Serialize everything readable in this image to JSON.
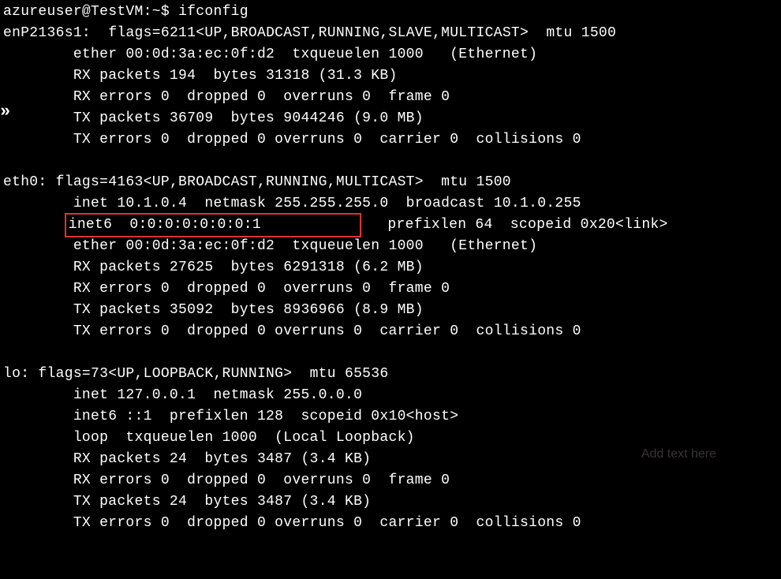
{
  "prompt": {
    "user_host": "azureuser@TestVM",
    "path": ":~$",
    "command": "ifconfig"
  },
  "side_marker": "»",
  "interfaces": {
    "enp": {
      "name": "enP2136s1:",
      "flags_line": "  flags=6211<UP,BROADCAST,RUNNING,SLAVE,MULTICAST>  mtu 1500",
      "ether_line": "        ether 00:0d:3a:ec:0f:d2  txqueuelen 1000   (Ethernet)",
      "rx_packets": "        RX packets 194  bytes 31318 (31.3 KB)",
      "rx_errors": "        RX errors 0  dropped 0  overruns 0  frame 0",
      "tx_packets": "        TX packets 36709  bytes 9044246 (9.0 MB)",
      "tx_errors": "        TX errors 0  dropped 0 overruns 0  carrier 0  collisions 0"
    },
    "eth0": {
      "name": "eth0:",
      "flags_line": " flags=4163<UP,BROADCAST,RUNNING,MULTICAST>  mtu 1500",
      "inet_line": "        inet 10.1.0.4  netmask 255.255.255.0  broadcast 10.1.0.255",
      "inet6_highlighted": "inet6  0:0:0:0:0:0:0:1           ",
      "inet6_suffix": "   prefixlen 64  scopeid 0x20<link>",
      "inet6_prefix": "       ",
      "ether_line": "        ether 00:0d:3a:ec:0f:d2  txqueuelen 1000   (Ethernet)",
      "rx_packets": "        RX packets 27625  bytes 6291318 (6.2 MB)",
      "rx_errors": "        RX errors 0  dropped 0  overruns 0  frame 0",
      "tx_packets": "        TX packets 35092  bytes 8936966 (8.9 MB)",
      "tx_errors": "        TX errors 0  dropped 0 overruns 0  carrier 0  collisions 0"
    },
    "lo": {
      "name": "lo:",
      "flags_line": " flags=73<UP,LOOPBACK,RUNNING>  mtu 65536",
      "inet_line": "        inet 127.0.0.1  netmask 255.0.0.0",
      "inet6_line": "        inet6 ::1  prefixlen 128  scopeid 0x10<host>",
      "loop_line": "        loop  txqueuelen 1000  (Local Loopback)",
      "rx_packets": "        RX packets 24  bytes 3487 (3.4 KB)",
      "rx_errors": "        RX errors 0  dropped 0  overruns 0  frame 0",
      "tx_packets": "        TX packets 24  bytes 3487 (3.4 KB)",
      "tx_errors": "        TX errors 0  dropped 0 overruns 0  carrier 0  collisions 0"
    }
  },
  "placeholder": "Add text here"
}
